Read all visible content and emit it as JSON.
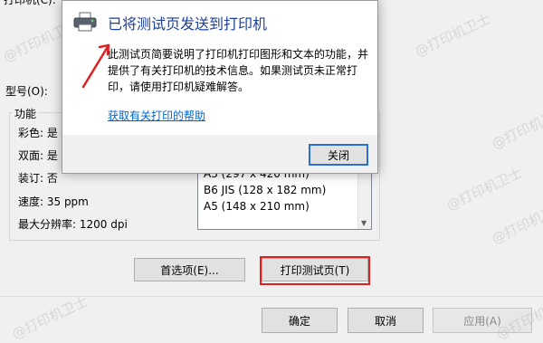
{
  "background": {
    "top_label": "打印机(C):",
    "model_label": "型号(O):",
    "features": {
      "title": "功能",
      "color": "彩色: 是",
      "duplex": "双面: 是",
      "staple": "装订: 否",
      "speed": "速度: 35 ppm",
      "max_resolution": "最大分辨率: 1200 dpi"
    },
    "paper_list": [
      "A3 (297 x 420 mm)",
      "B6 JIS (128 x 182 mm)",
      "A5 (148 x 210 mm)"
    ],
    "preferences_button": "首选项(E)...",
    "print_test_button": "打印测试页(T)",
    "ok_button": "确定",
    "cancel_button": "取消",
    "apply_button": "应用(A)"
  },
  "dialog": {
    "title": "已将测试页发送到打印机",
    "message": "此测试页简要说明了打印机打印图形和文本的功能，并提供了有关打印机的技术信息。如果测试页未正常打印，请使用打印机疑难解答。",
    "help_link": "获取有关打印的帮助",
    "close_button": "关闭"
  },
  "watermark": "@打印机卫士",
  "colors": {
    "link": "#0066cc",
    "title": "#1f3f9a",
    "highlight": "#e02020",
    "focus_border": "#2b6fd6"
  }
}
